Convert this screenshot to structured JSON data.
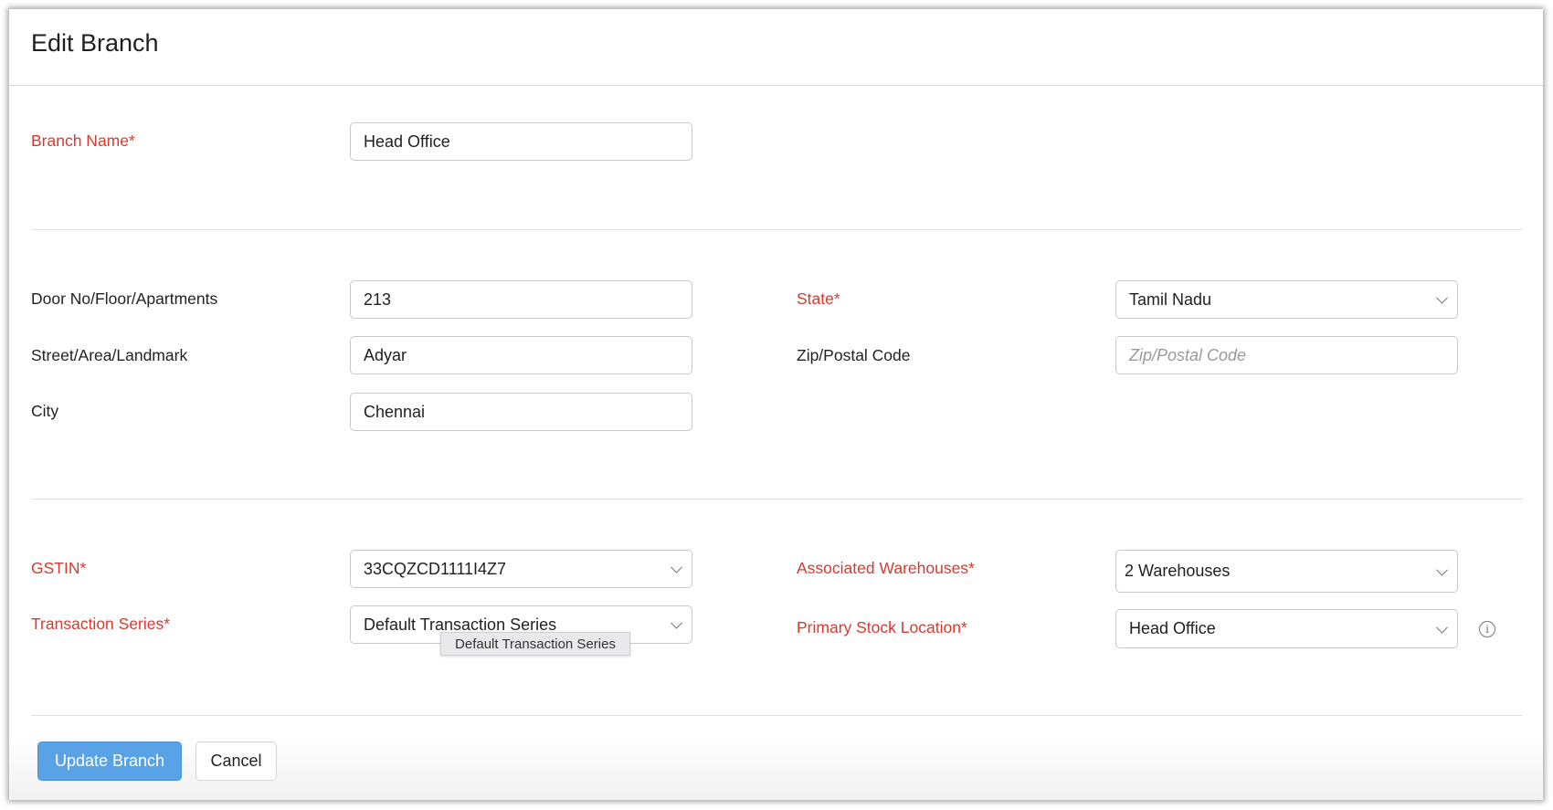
{
  "title": "Edit Branch",
  "fields": {
    "branch_name": {
      "label": "Branch Name*",
      "value": "Head Office"
    },
    "door": {
      "label": "Door No/Floor/Apartments",
      "value": "213"
    },
    "street": {
      "label": "Street/Area/Landmark",
      "value": "Adyar"
    },
    "city": {
      "label": "City",
      "value": "Chennai"
    },
    "state": {
      "label": "State*",
      "value": "Tamil Nadu"
    },
    "zip": {
      "label": "Zip/Postal Code",
      "placeholder": "Zip/Postal Code"
    },
    "gstin": {
      "label": "GSTIN*",
      "value": "33CQZCD1111I4Z7"
    },
    "transaction_series": {
      "label": "Transaction Series*",
      "value": "Default Transaction Series",
      "tooltip": "Default Transaction Series"
    },
    "warehouses": {
      "label": "Associated Warehouses*",
      "value": "2 Warehouses"
    },
    "primary_stock": {
      "label": "Primary Stock Location*",
      "value": "Head Office"
    }
  },
  "buttons": {
    "update": "Update Branch",
    "cancel": "Cancel"
  },
  "colors": {
    "required": "#d63a2f",
    "primary": "#5aa2e6"
  }
}
